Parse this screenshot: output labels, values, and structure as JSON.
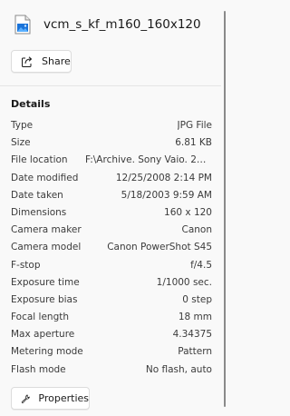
{
  "file": {
    "name": "vcm_s_kf_m160_160x120",
    "icon": "image-file-icon"
  },
  "actions": {
    "share_label": "Share",
    "properties_label": "Properties"
  },
  "details": {
    "title": "Details",
    "rows": [
      {
        "label": "Type",
        "value": "JPG File"
      },
      {
        "label": "Size",
        "value": "6.81 KB"
      },
      {
        "label": "File location",
        "value": "F:\\Archive. Sony Vaio. 2003.20..."
      },
      {
        "label": "Date modified",
        "value": "12/25/2008 2:14 PM"
      },
      {
        "label": "Date taken",
        "value": "5/18/2003 9:59 AM"
      },
      {
        "label": "Dimensions",
        "value": "160 x 120"
      },
      {
        "label": "Camera maker",
        "value": "Canon"
      },
      {
        "label": "Camera model",
        "value": "Canon PowerShot S45"
      },
      {
        "label": "F-stop",
        "value": "f/4.5"
      },
      {
        "label": "Exposure time",
        "value": "1/1000 sec."
      },
      {
        "label": "Exposure bias",
        "value": "0 step"
      },
      {
        "label": "Focal length",
        "value": "18 mm"
      },
      {
        "label": "Max aperture",
        "value": "4.34375"
      },
      {
        "label": "Metering mode",
        "value": "Pattern"
      },
      {
        "label": "Flash mode",
        "value": "No flash, auto"
      }
    ]
  },
  "colors": {
    "accent": "#0067c0",
    "background": "#f9f9f9"
  }
}
